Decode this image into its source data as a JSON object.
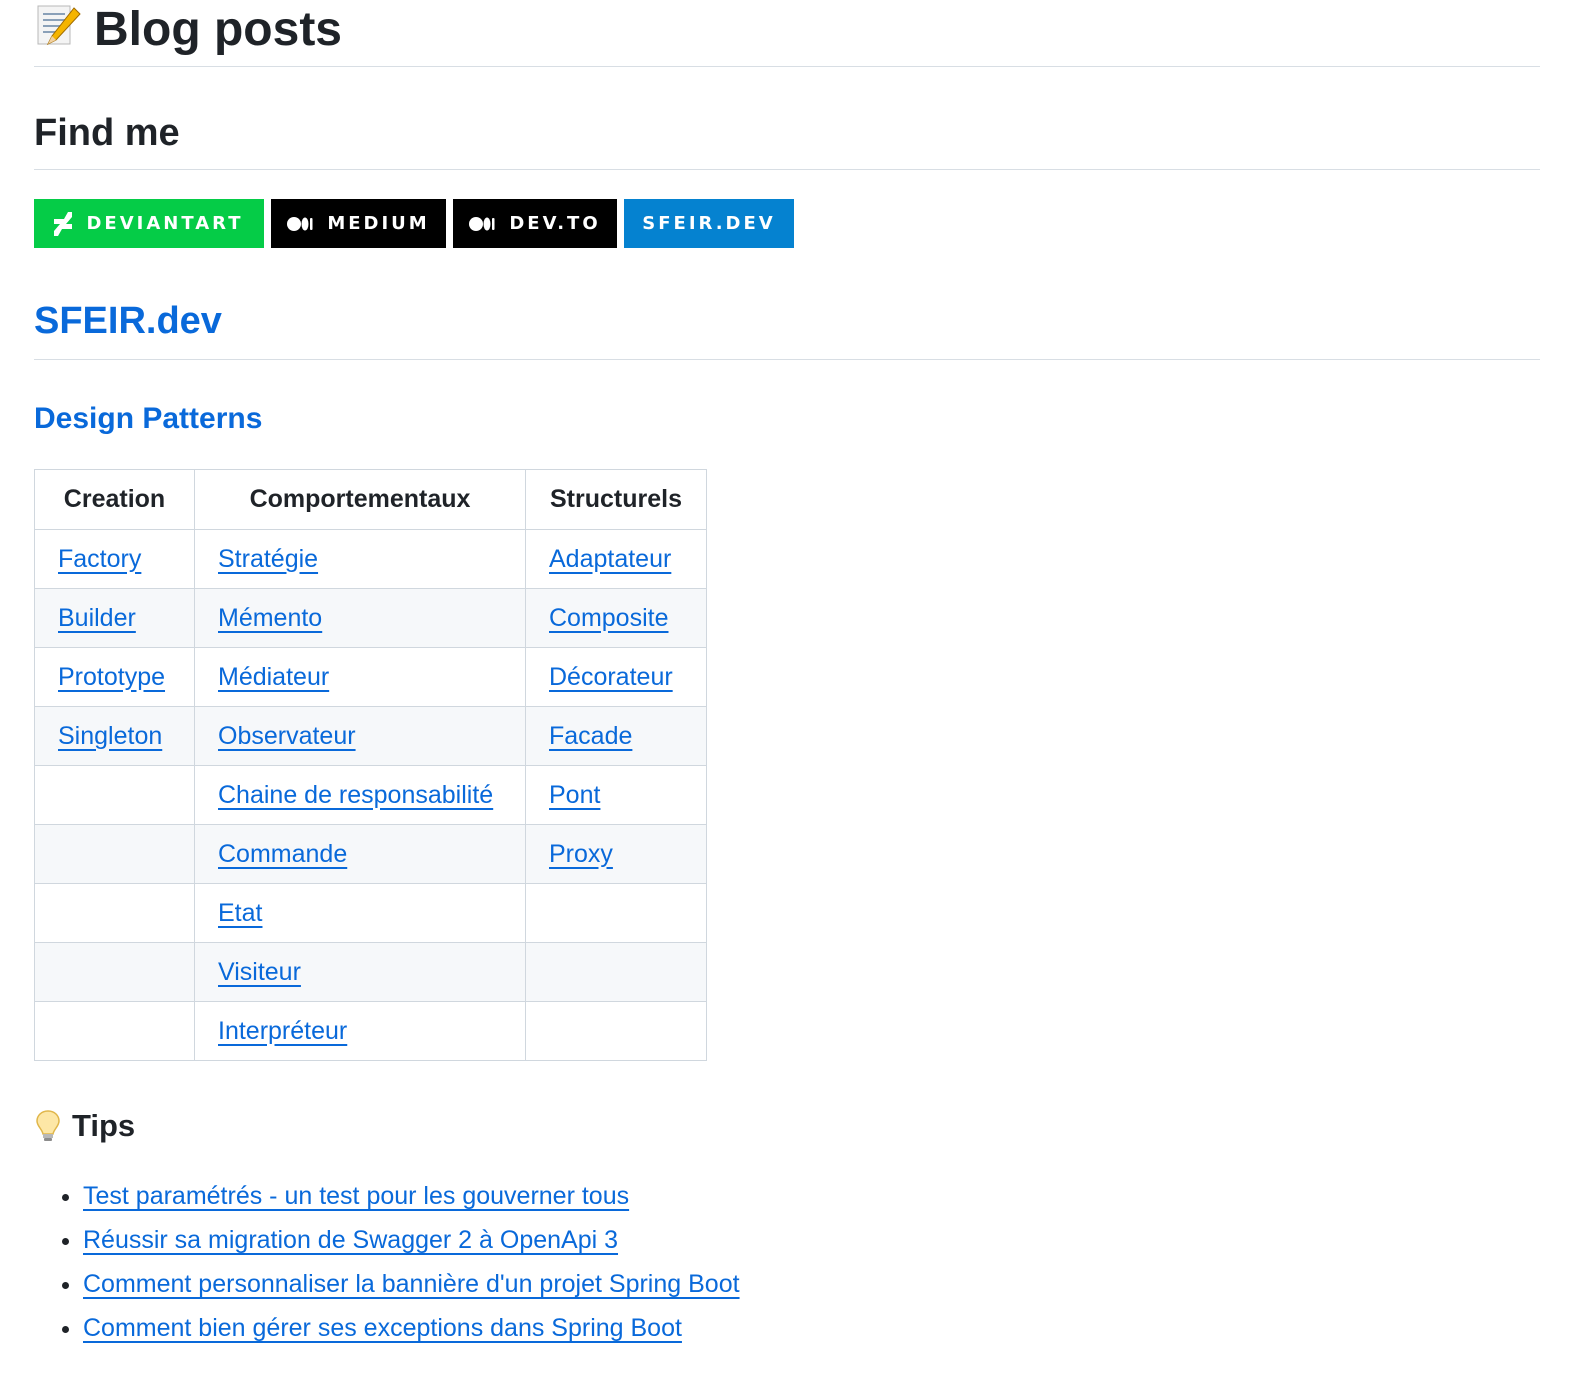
{
  "header": {
    "title": "Blog posts",
    "emoji": "memo-icon"
  },
  "find_me": {
    "title": "Find me",
    "badges": [
      {
        "label": "DEVIANTART",
        "icon": "deviantart-icon",
        "color": "#05cc47"
      },
      {
        "label": "MEDIUM",
        "icon": "medium-icon",
        "color": "#000000"
      },
      {
        "label": "DEV.TO",
        "icon": "medium-icon",
        "color": "#000000"
      },
      {
        "label": "SFEIR.DEV",
        "icon": "",
        "color": "#0582d0"
      }
    ]
  },
  "sfeir": {
    "title": "SFEIR.dev",
    "design_patterns": {
      "title": "Design Patterns",
      "columns": [
        "Creation",
        "Comportementaux",
        "Structurels"
      ],
      "rows": [
        [
          "Factory",
          "Stratégie",
          "Adaptateur"
        ],
        [
          "Builder",
          "Mémento",
          "Composite"
        ],
        [
          "Prototype",
          "Médiateur",
          "Décorateur"
        ],
        [
          "Singleton",
          "Observateur",
          "Facade"
        ],
        [
          "",
          "Chaine de responsabilité",
          "Pont"
        ],
        [
          "",
          "Commande",
          "Proxy"
        ],
        [
          "",
          "Etat",
          ""
        ],
        [
          "",
          "Visiteur",
          ""
        ],
        [
          "",
          "Interpréteur",
          ""
        ]
      ]
    }
  },
  "tips": {
    "title": "Tips",
    "icon": "lightbulb-icon",
    "items": [
      "Test paramétrés - un test pour les gouverner tous",
      "Réussir sa migration de Swagger 2 à OpenApi 3",
      "Comment personnaliser la bannière d'un projet Spring Boot",
      "Comment bien gérer ses exceptions dans Spring Boot"
    ]
  },
  "colors": {
    "link": "#0969da",
    "text": "#1f2328",
    "border": "#d0d7de"
  }
}
